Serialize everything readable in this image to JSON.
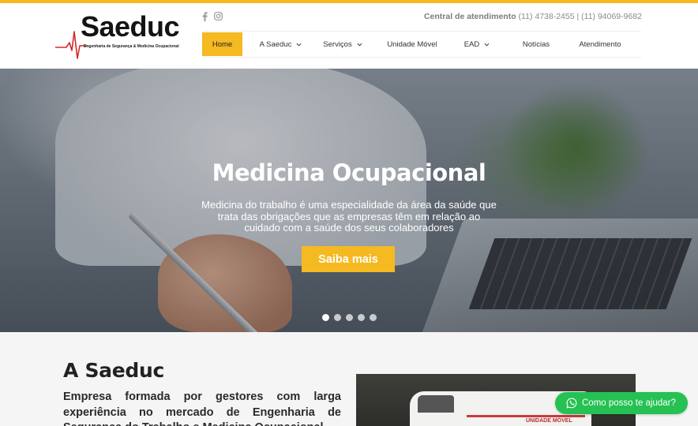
{
  "brand": {
    "name": "Saeduc",
    "tagline": "Engenharia de Segurança & Medicina Ocupacional",
    "accent": "#f5b921",
    "pulse_color": "#d62828"
  },
  "social": {
    "facebook_icon": "facebook-icon",
    "instagram_icon": "instagram-icon"
  },
  "contact": {
    "label": "Central de atendimento",
    "phones": "(11) 4738-2455 | (11) 94069-9682"
  },
  "nav": {
    "items": [
      {
        "label": "Home",
        "active": true,
        "has_dropdown": false
      },
      {
        "label": "A Saeduc",
        "active": false,
        "has_dropdown": true
      },
      {
        "label": "Serviços",
        "active": false,
        "has_dropdown": true
      },
      {
        "label": "Unidade Móvel",
        "active": false,
        "has_dropdown": false
      },
      {
        "label": "EAD",
        "active": false,
        "has_dropdown": true
      },
      {
        "label": "Notícias",
        "active": false,
        "has_dropdown": false
      },
      {
        "label": "Atendimento",
        "active": false,
        "has_dropdown": false
      }
    ]
  },
  "hero": {
    "title": "Medicina Ocupacional",
    "text": "Medicina do trabalho é uma especialidade da área da saúde que trata das obrigações que as empresas têm em relação ao cuidado com a saúde dos seus colaboradores",
    "button_label": "Saiba mais",
    "slide_count": 5,
    "active_slide": 1
  },
  "about": {
    "title": "A Saeduc",
    "text": "Empresa formada por gestores com larga experiência no mercado de Engenharia de Segurança do Trabalho e Medicina Ocupacional,",
    "image_label": "UNIDADE MÓVEL"
  },
  "whatsapp": {
    "label": "Como posso te ajudar?",
    "icon": "whatsapp-icon",
    "color": "#25c152"
  }
}
